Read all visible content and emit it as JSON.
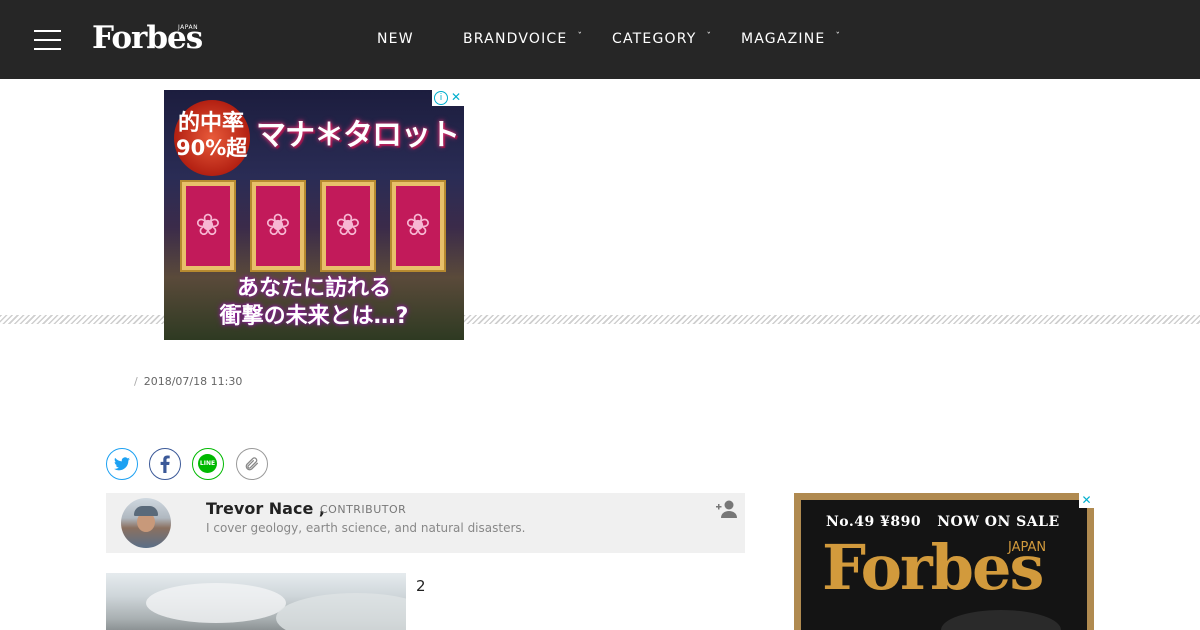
{
  "header": {
    "logo": "Forbes",
    "logo_sub": "JAPAN",
    "nav": [
      {
        "label": "NEW",
        "has_dropdown": false
      },
      {
        "label": "BRANDVOICE",
        "has_dropdown": true
      },
      {
        "label": "CATEGORY",
        "has_dropdown": true
      },
      {
        "label": "MAGAZINE",
        "has_dropdown": true
      }
    ],
    "dropdown_glyph": "ˇ"
  },
  "top_ad": {
    "badge_line1": "的中率",
    "badge_line2": "90%超",
    "title": "マナ＊タロット",
    "line1": "あなたに訪れる",
    "line2": "衝撃の未来とは…?",
    "info_glyph": "i",
    "close_glyph": "✕"
  },
  "article": {
    "datetime": "2018/07/18 11:30",
    "number": "2"
  },
  "share": [
    "twitter-icon",
    "facebook-icon",
    "line-icon",
    "link-icon"
  ],
  "share_line_text": "LINE",
  "author": {
    "name": "Trevor Nace ,",
    "role": "CONTRIBUTOR",
    "description": "I cover geology, earth science, and natural disasters."
  },
  "side_ad": {
    "issue": "No.49 ¥890   NOW ON SALE",
    "brand": "Forbes",
    "brand_sub": "JAPAN",
    "close_glyph": "✕"
  },
  "colors": {
    "header_bg": "#262626",
    "twitter": "#1da1f2",
    "facebook": "#3b5998",
    "line": "#00b900",
    "ad_gold": "#d29a3c"
  }
}
